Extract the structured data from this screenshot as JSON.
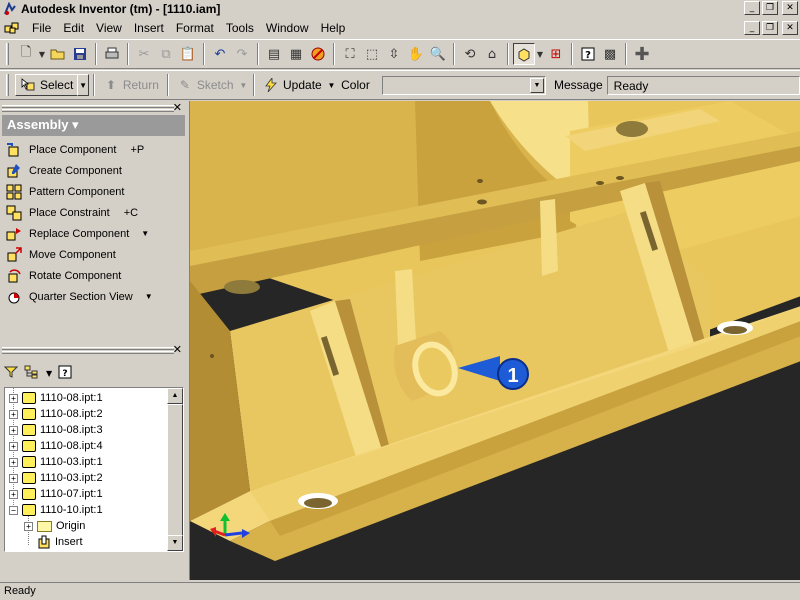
{
  "window": {
    "title": "Autodesk Inventor (tm) - [1110.iam]",
    "buttons": {
      "minimize": "_",
      "restore": "❐",
      "close": "✕"
    }
  },
  "menu": {
    "items": [
      "File",
      "Edit",
      "View",
      "Insert",
      "Format",
      "Tools",
      "Window",
      "Help"
    ]
  },
  "command_bar": {
    "select_label": "Select",
    "return_label": "Return",
    "sketch_label": "Sketch",
    "update_label": "Update",
    "color_label": "Color",
    "color_value": "",
    "message_label": "Message",
    "message_value": "Ready"
  },
  "panel_bar": {
    "header": "Assembly ▾",
    "commands": [
      {
        "label": "Place Component",
        "shortcut": "+P",
        "icon": "place-component-icon"
      },
      {
        "label": "Create Component",
        "shortcut": "",
        "icon": "create-component-icon"
      },
      {
        "label": "Pattern Component",
        "shortcut": "",
        "icon": "pattern-component-icon"
      },
      {
        "label": "Place Constraint",
        "shortcut": "+C",
        "icon": "place-constraint-icon"
      },
      {
        "label": "Replace Component",
        "shortcut": "",
        "more": "▼",
        "icon": "replace-component-icon"
      },
      {
        "label": "Move Component",
        "shortcut": "",
        "icon": "move-component-icon"
      },
      {
        "label": "Rotate Component",
        "shortcut": "",
        "icon": "rotate-component-icon"
      },
      {
        "label": "Quarter Section View",
        "shortcut": "",
        "more": "▼",
        "icon": "section-view-icon"
      }
    ]
  },
  "browser": {
    "items": [
      {
        "label": "1110-08.ipt:1",
        "type": "part"
      },
      {
        "label": "1110-08.ipt:2",
        "type": "part"
      },
      {
        "label": "1110-08.ipt:3",
        "type": "part"
      },
      {
        "label": "1110-08.ipt:4",
        "type": "part"
      },
      {
        "label": "1110-03.ipt:1",
        "type": "part"
      },
      {
        "label": "1110-03.ipt:2",
        "type": "part"
      },
      {
        "label": "1110-07.ipt:1",
        "type": "part"
      },
      {
        "label": "1110-10.ipt:1",
        "type": "part"
      },
      {
        "label": "Origin",
        "type": "folder"
      },
      {
        "label": "Insert",
        "type": "constraint"
      }
    ]
  },
  "viewport": {
    "callout_number": "1",
    "colors": {
      "background": "#262626",
      "part": "#f0cf6a",
      "callout": "#1e5bd6"
    }
  },
  "status": {
    "text": "Ready"
  }
}
